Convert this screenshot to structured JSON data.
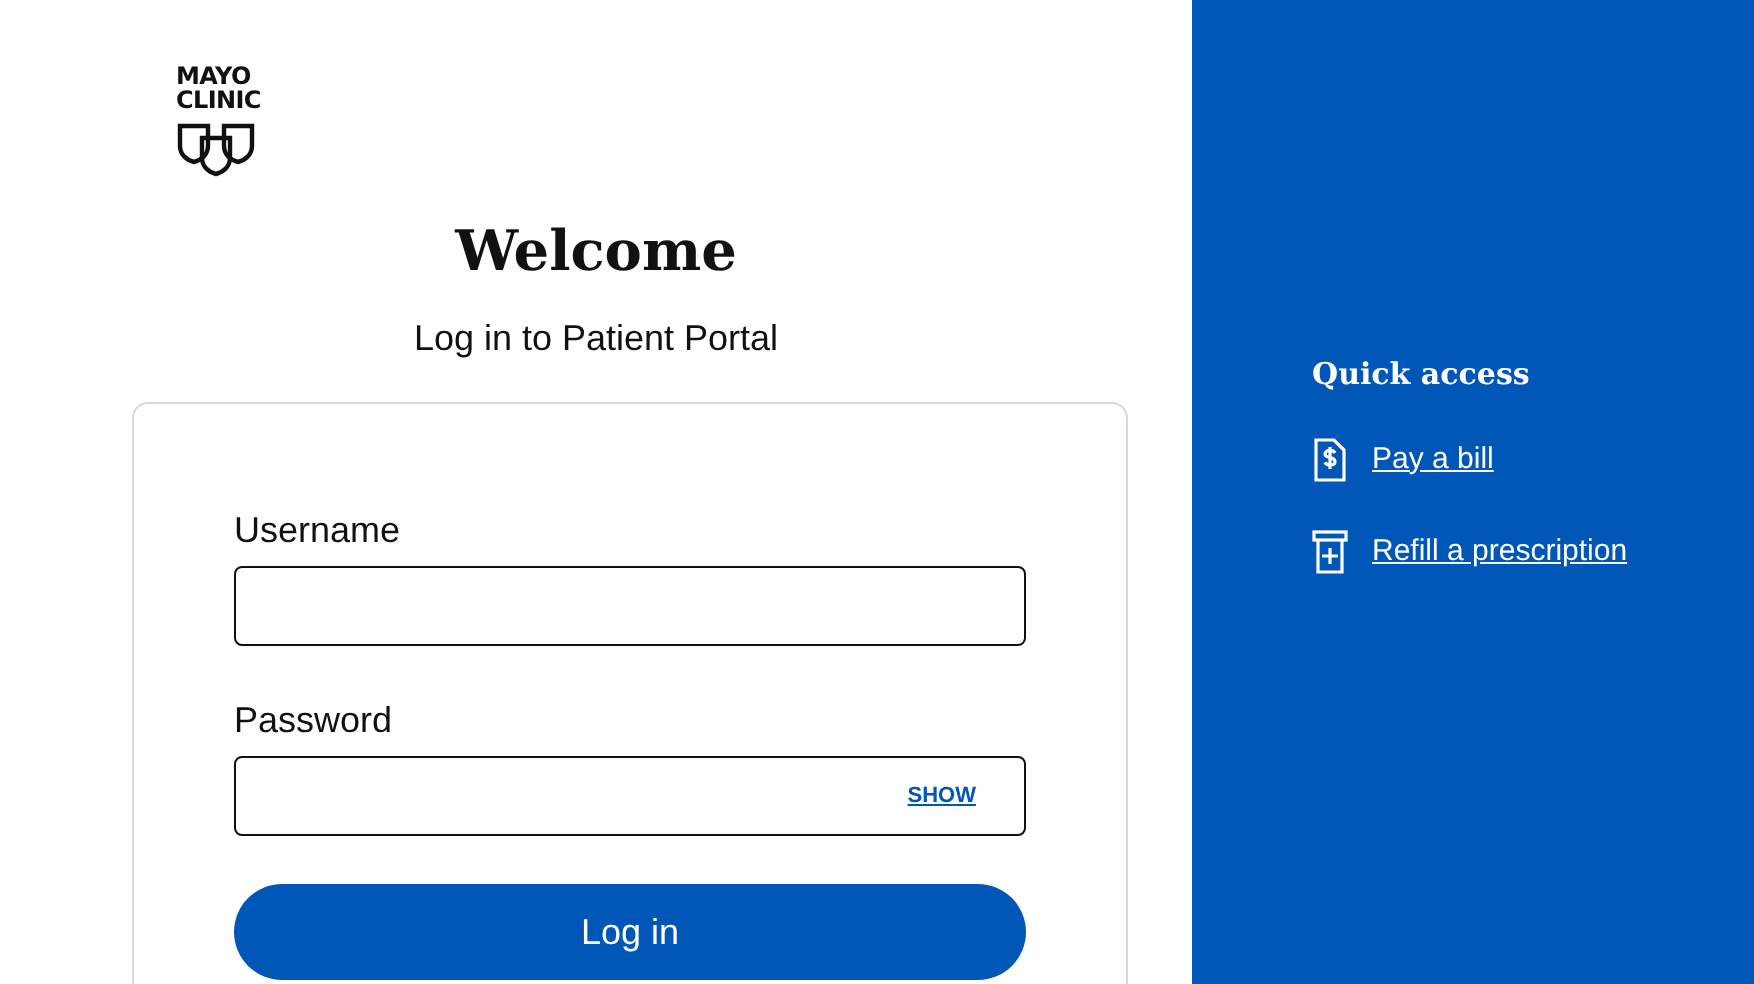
{
  "logo": {
    "line_1": "MAYO",
    "line_2": "CLINIC"
  },
  "heading": "Welcome",
  "subheading": "Log in to Patient Portal",
  "form": {
    "fields": [
      {
        "label": "Username"
      },
      {
        "label": "Password",
        "toggle": "SHOW"
      }
    ],
    "submit": "Log in"
  },
  "quick_access": {
    "title": "Quick access",
    "links": [
      {
        "label": "Pay a bill",
        "kind": "bill"
      },
      {
        "label": "Refill a prescription",
        "kind": "prescription"
      }
    ]
  }
}
